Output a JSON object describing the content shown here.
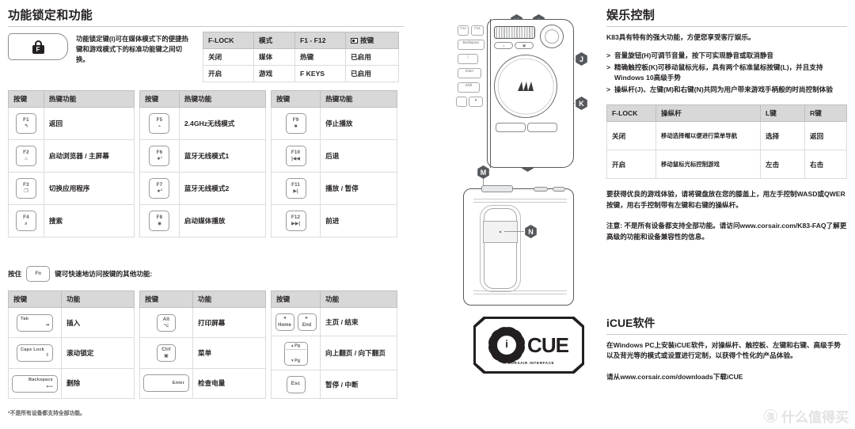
{
  "left": {
    "title": "功能锁定和功能",
    "flock_keycap_icon": "lock-f-icon",
    "flock_description": "功能锁定键(I)可在媒体模式下的便捷热键和游戏模式下的标准功能键之间切换。",
    "flock_table": {
      "headers": [
        "F-LOCK",
        "模式",
        "F1 - F12",
        "按键"
      ],
      "header_icon": "keyboard-icon",
      "rows": [
        [
          "关闭",
          "媒体",
          "热键",
          "已启用"
        ],
        [
          "开启",
          "游戏",
          "F KEYS",
          "已启用"
        ]
      ]
    },
    "hotkey_tables": [
      {
        "headers": [
          "按键",
          "热键功能"
        ],
        "rows": [
          {
            "key_top": "F1",
            "key_bot": "↰",
            "function": "返回"
          },
          {
            "key_top": "F2",
            "key_bot": "⌂",
            "function": "启动浏览器 / 主屏幕"
          },
          {
            "key_top": "F3",
            "key_bot": "❐",
            "function": "切换应用程序"
          },
          {
            "key_top": "F4",
            "key_bot": "⌕",
            "function": "搜索"
          }
        ]
      },
      {
        "headers": [
          "按键",
          "热键功能"
        ],
        "rows": [
          {
            "key_top": "F5",
            "key_bot": "⌁",
            "function": "2.4GHz无线模式"
          },
          {
            "key_top": "F6",
            "key_bot": "∗¹",
            "function": "蓝牙无线模式1"
          },
          {
            "key_top": "F7",
            "key_bot": "∗²",
            "function": "蓝牙无线模式2"
          },
          {
            "key_top": "F8",
            "key_bot": "◉",
            "function": "启动媒体播放"
          }
        ]
      },
      {
        "headers": [
          "按键",
          "热键功能"
        ],
        "rows": [
          {
            "key_top": "F9",
            "key_bot": "■",
            "function": "停止播放"
          },
          {
            "key_top": "F10",
            "key_bot": "|◀◀",
            "function": "后退"
          },
          {
            "key_top": "F11",
            "key_bot": "▶|",
            "function": "播放 / 暂停"
          },
          {
            "key_top": "F12",
            "key_bot": "▶▶|",
            "function": "前进"
          }
        ]
      }
    ],
    "fn_line_before": "按住",
    "fn_key_label": "Fn",
    "fn_line_after": "键可快速地访问按键的其他功能:",
    "fn_tables": [
      {
        "headers": [
          "按键",
          "功能"
        ],
        "rows": [
          {
            "key_top": "Tab",
            "key_bot": "⇥",
            "style": "wide",
            "function": "插入"
          },
          {
            "key_top": "Caps Lock",
            "key_bot": "⇪",
            "style": "wide",
            "function": "滚动锁定"
          },
          {
            "key_top": "Backspace",
            "key_bot": "⟵",
            "style": "xwide",
            "function": "删除"
          }
        ]
      },
      {
        "headers": [
          "按键",
          "功能"
        ],
        "rows": [
          {
            "key_top": "Alt",
            "key_bot": "⌥",
            "style": "sq",
            "function": "打印屏幕"
          },
          {
            "key_top": "Ctrl",
            "key_bot": "▣",
            "style": "sq",
            "function": "菜单"
          },
          {
            "key_top": "Enter",
            "key_bot": "",
            "style": "xwide",
            "function": "检查电量"
          }
        ]
      },
      {
        "headers": [
          "按键",
          "功能"
        ],
        "rows": [
          {
            "key_top": "◂",
            "key_bot": "Home",
            "style": "pair",
            "key2_top": "▸",
            "key2_bot": "End",
            "function": "主页 / 结束"
          },
          {
            "key_top": "▴ Pg",
            "key_bot": "▾ Pg",
            "style": "stack",
            "function": "向上翻页 / 向下翻页"
          },
          {
            "key_top": "Esc",
            "key_bot": "",
            "style": "sq",
            "function": "暂停 / 中断"
          }
        ]
      }
    ],
    "footnote": "*不是所有设备都支持全部功能。"
  },
  "diagram": {
    "callouts": [
      "H",
      "I",
      "J",
      "K",
      "L",
      "M",
      "N"
    ],
    "keys": [
      "F12",
      "Backspace",
      "Enter",
      "Shift",
      "|"
    ],
    "brand_icon": "corsair-sails-icon"
  },
  "right": {
    "title": "娱乐控制",
    "intro": "K83具有特有的强大功能，方便您享受客厅娱乐。",
    "bullets": [
      "音量旋钮(H)可调节音量，按下可实现静音或取消静音",
      "精确触控板(K)可移动鼠标光标，具有两个标准鼠标按键(L)，并且支持Windows 10高级手势",
      "操纵杆(J)、左键(M)和右键(N)共同为用户带来游戏手柄般的时尚控制体验"
    ],
    "bullet_marker": ">",
    "joystick_table": {
      "headers": [
        "F-LOCK",
        "操纵杆",
        "L键",
        "R键"
      ],
      "rows": [
        [
          "关闭",
          "移动选择帽以便进行菜单导航",
          "选择",
          "返回"
        ],
        [
          "开启",
          "移动鼠标光标控制游戏",
          "左击",
          "右击"
        ]
      ]
    },
    "para1": "要获得优良的游戏体验，请将键盘放在您的膝盖上，用左手控制WASD或QWER按键，用右手控制带有左键和右键的操纵杆。",
    "para2": "注意: 不是所有设备都支持全部功能。请访问www.corsair.com/K83-FAQ了解更高级的功能和设备兼容性的信息。"
  },
  "icue": {
    "logo_word": "CUE",
    "logo_sub": "A CORSAIR INTERFACE",
    "title": "iCUE软件",
    "body": "在Windows PC上安装iCUE软件，对操纵杆、触控板、左键和右键、高级手势以及背光等的模式或设置进行定制，以获得个性化的产品体验。",
    "download": "请从www.corsair.com/downloads下载iCUE"
  },
  "watermark": {
    "mark": "值",
    "text": "什么值得买"
  }
}
